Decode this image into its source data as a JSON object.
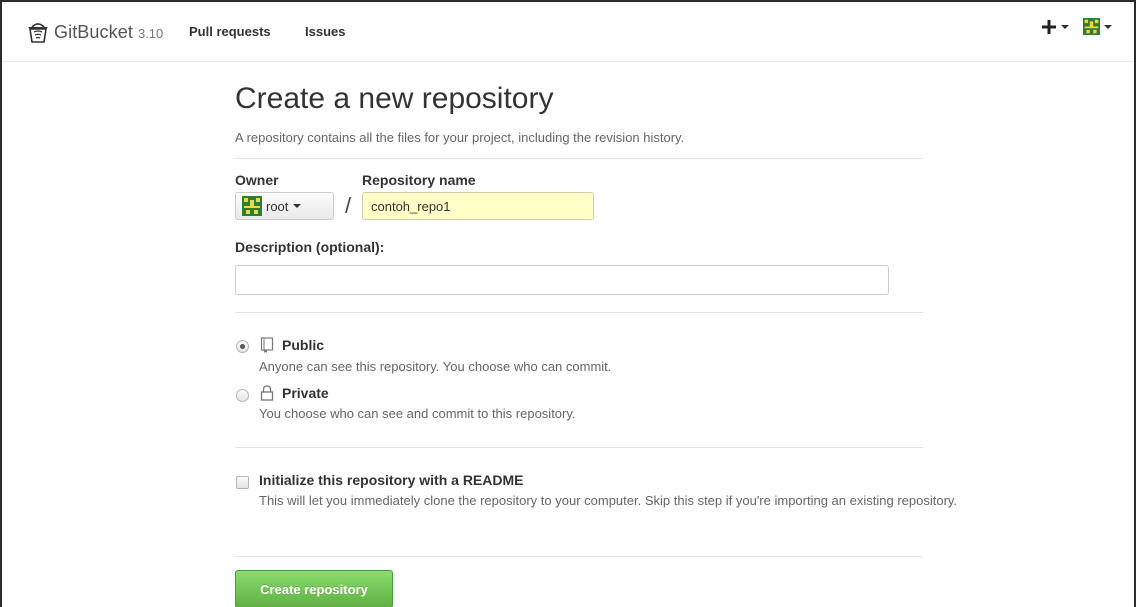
{
  "header": {
    "brand_name": "GitBucket",
    "brand_version": "3.10",
    "nav": [
      {
        "label": "Pull requests"
      },
      {
        "label": "Issues"
      }
    ],
    "new_menu_icon": "plus-icon",
    "user_menu_icon": "avatar-icon"
  },
  "page": {
    "title": "Create a new repository",
    "description": "A repository contains all the files for your project, including the revision history."
  },
  "form": {
    "owner_label": "Owner",
    "owner_value": "root",
    "separator": "/",
    "repo_name_label": "Repository name",
    "repo_name_value": "contoh_repo1",
    "description_label": "Description (optional):",
    "description_value": "",
    "visibility": [
      {
        "title": "Public",
        "desc": "Anyone can see this repository. You choose who can commit.",
        "icon": "book-icon",
        "checked": true
      },
      {
        "title": "Private",
        "desc": "You choose who can see and commit to this repository.",
        "icon": "lock-icon",
        "checked": false
      }
    ],
    "readme": {
      "title": "Initialize this repository with a README",
      "desc": "This will let you immediately clone the repository to your computer. Skip this step if you're importing an existing repository.",
      "checked": false
    },
    "submit_label": "Create repository"
  },
  "colors": {
    "repo_input_bg": "#ffffc8",
    "submit_green": "#60b044",
    "avatar_green": "#2e7d32",
    "avatar_yellow": "#e8d84a"
  }
}
